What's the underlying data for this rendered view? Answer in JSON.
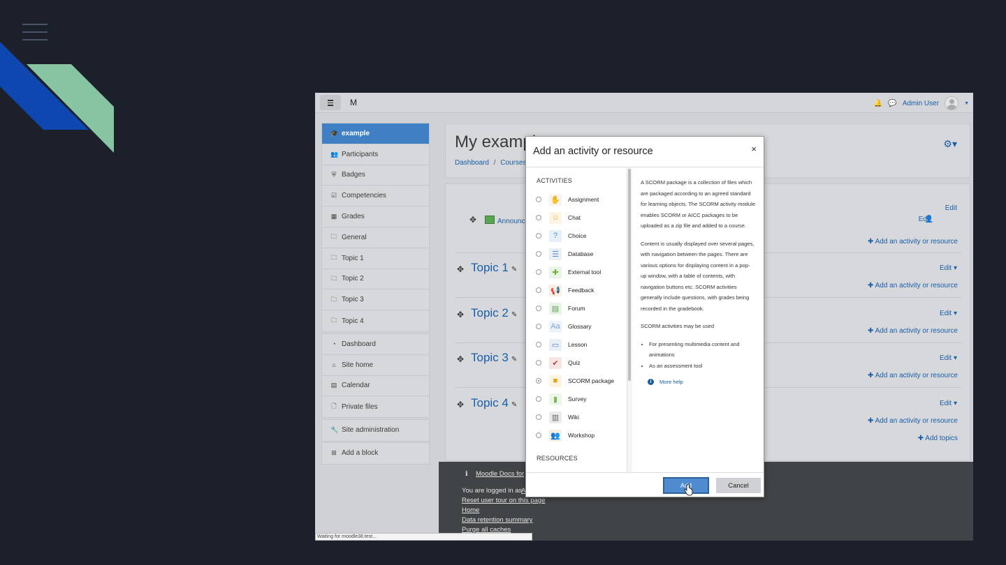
{
  "app": {
    "brand": "M",
    "user_name": "Admin User"
  },
  "drawer": {
    "course_items": [
      {
        "label": "example",
        "icon": "graduation-cap-icon",
        "active": true
      },
      {
        "label": "Participants",
        "icon": "users-icon"
      },
      {
        "label": "Badges",
        "icon": "shield-icon"
      },
      {
        "label": "Competencies",
        "icon": "check-square-icon"
      },
      {
        "label": "Grades",
        "icon": "table-icon"
      },
      {
        "label": "General",
        "icon": "folder-icon"
      },
      {
        "label": "Topic 1",
        "icon": "folder-icon"
      },
      {
        "label": "Topic 2",
        "icon": "folder-icon"
      },
      {
        "label": "Topic 3",
        "icon": "folder-icon"
      },
      {
        "label": "Topic 4",
        "icon": "folder-icon"
      }
    ],
    "site_items": [
      {
        "label": "Dashboard",
        "icon": "dashboard-icon"
      },
      {
        "label": "Site home",
        "icon": "home-icon"
      },
      {
        "label": "Calendar",
        "icon": "calendar-icon"
      },
      {
        "label": "Private files",
        "icon": "file-icon"
      }
    ],
    "admin_label": "Site administration",
    "add_block_label": "Add a block"
  },
  "header": {
    "title": "My exampl",
    "breadcrumb": [
      "Dashboard",
      "Courses"
    ]
  },
  "course": {
    "announcements_label": "Announc",
    "edit_label": "Edit",
    "add_activity_label": "Add an activity or resource",
    "add_topics_label": "Add topics",
    "topics": [
      "Topic 1",
      "Topic 2",
      "Topic 3",
      "Topic 4"
    ]
  },
  "footer": {
    "docs_link": "Moodle Docs for",
    "logged_in_text": "You are logged in as",
    "logged_in_user": "A",
    "links": [
      "Reset user tour on this page",
      "Home",
      "Data retention summary",
      "Purge all caches"
    ]
  },
  "status_bar": "Waiting for moodle38.test...",
  "modal": {
    "title": "Add an activity or resource",
    "close": "×",
    "activities_heading": "ACTIVITIES",
    "resources_heading": "RESOURCES",
    "activities": [
      {
        "label": "Assignment",
        "icon": "assignment-icon",
        "color": "#c9a26b"
      },
      {
        "label": "Chat",
        "icon": "chat-icon",
        "color": "#e8b23a"
      },
      {
        "label": "Choice",
        "icon": "choice-icon",
        "color": "#4a90d9"
      },
      {
        "label": "Database",
        "icon": "database-icon",
        "color": "#5b8fc9"
      },
      {
        "label": "External tool",
        "icon": "puzzle-icon",
        "color": "#6cb33f"
      },
      {
        "label": "Feedback",
        "icon": "megaphone-icon",
        "color": "#d9862b"
      },
      {
        "label": "Forum",
        "icon": "forum-icon",
        "color": "#5aa352"
      },
      {
        "label": "Glossary",
        "icon": "glossary-icon",
        "color": "#7aa6d8"
      },
      {
        "label": "Lesson",
        "icon": "lesson-icon",
        "color": "#4f86c6"
      },
      {
        "label": "Quiz",
        "icon": "quiz-icon",
        "color": "#c43d3d"
      },
      {
        "label": "SCORM package",
        "icon": "scorm-icon",
        "color": "#e8a21a",
        "selected": true
      },
      {
        "label": "Survey",
        "icon": "survey-icon",
        "color": "#7bb85a"
      },
      {
        "label": "Wiki",
        "icon": "wiki-icon",
        "color": "#666666"
      },
      {
        "label": "Workshop",
        "icon": "workshop-icon",
        "color": "#c98a2b"
      }
    ],
    "help": {
      "p1": "A SCORM package is a collection of files which are packaged according to an agreed standard for learning objects. The SCORM activity module enables SCORM or AICC packages to be uploaded as a zip file and added to a course.",
      "p2": "Content is usually displayed over several pages, with navigation between the pages. There are various options for displaying content in a pop-up window, with a table of contents, with navigation buttons etc. SCORM activities generally include questions, with grades being recorded in the gradebook.",
      "p3": "SCORM activities may be used",
      "bullets": [
        "For presenting multimedia content and animations",
        "As an assessment tool"
      ],
      "more_help": "More help"
    },
    "add_button": "Add",
    "cancel_button": "Cancel"
  },
  "colors": {
    "slide_bg": "#1b202b",
    "accent_blue": "#1a5ea8",
    "active_item": "#3f7fc4",
    "deco_blue": "#0f47b0",
    "deco_green": "#86c4a2"
  }
}
